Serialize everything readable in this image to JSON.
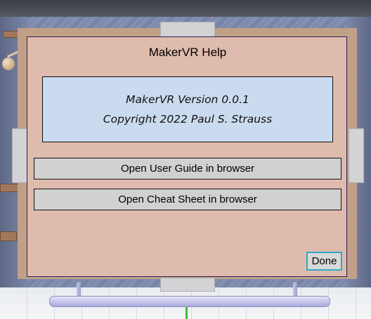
{
  "dialog": {
    "title": "MakerVR Help",
    "version_line": "MakerVR Version 0.0.1",
    "copyright_line": "Copyright 2022 Paul S. Strauss",
    "user_guide_label": "Open User Guide in browser",
    "cheat_sheet_label": "Open Cheat Sheet in browser",
    "done_label": "Done"
  },
  "colors": {
    "panel_background": "#dfbbad",
    "frame": "#c1a088",
    "info_box": "#cbdbef",
    "button": "#d1d1d1",
    "done_border": "#2fa9c7"
  }
}
